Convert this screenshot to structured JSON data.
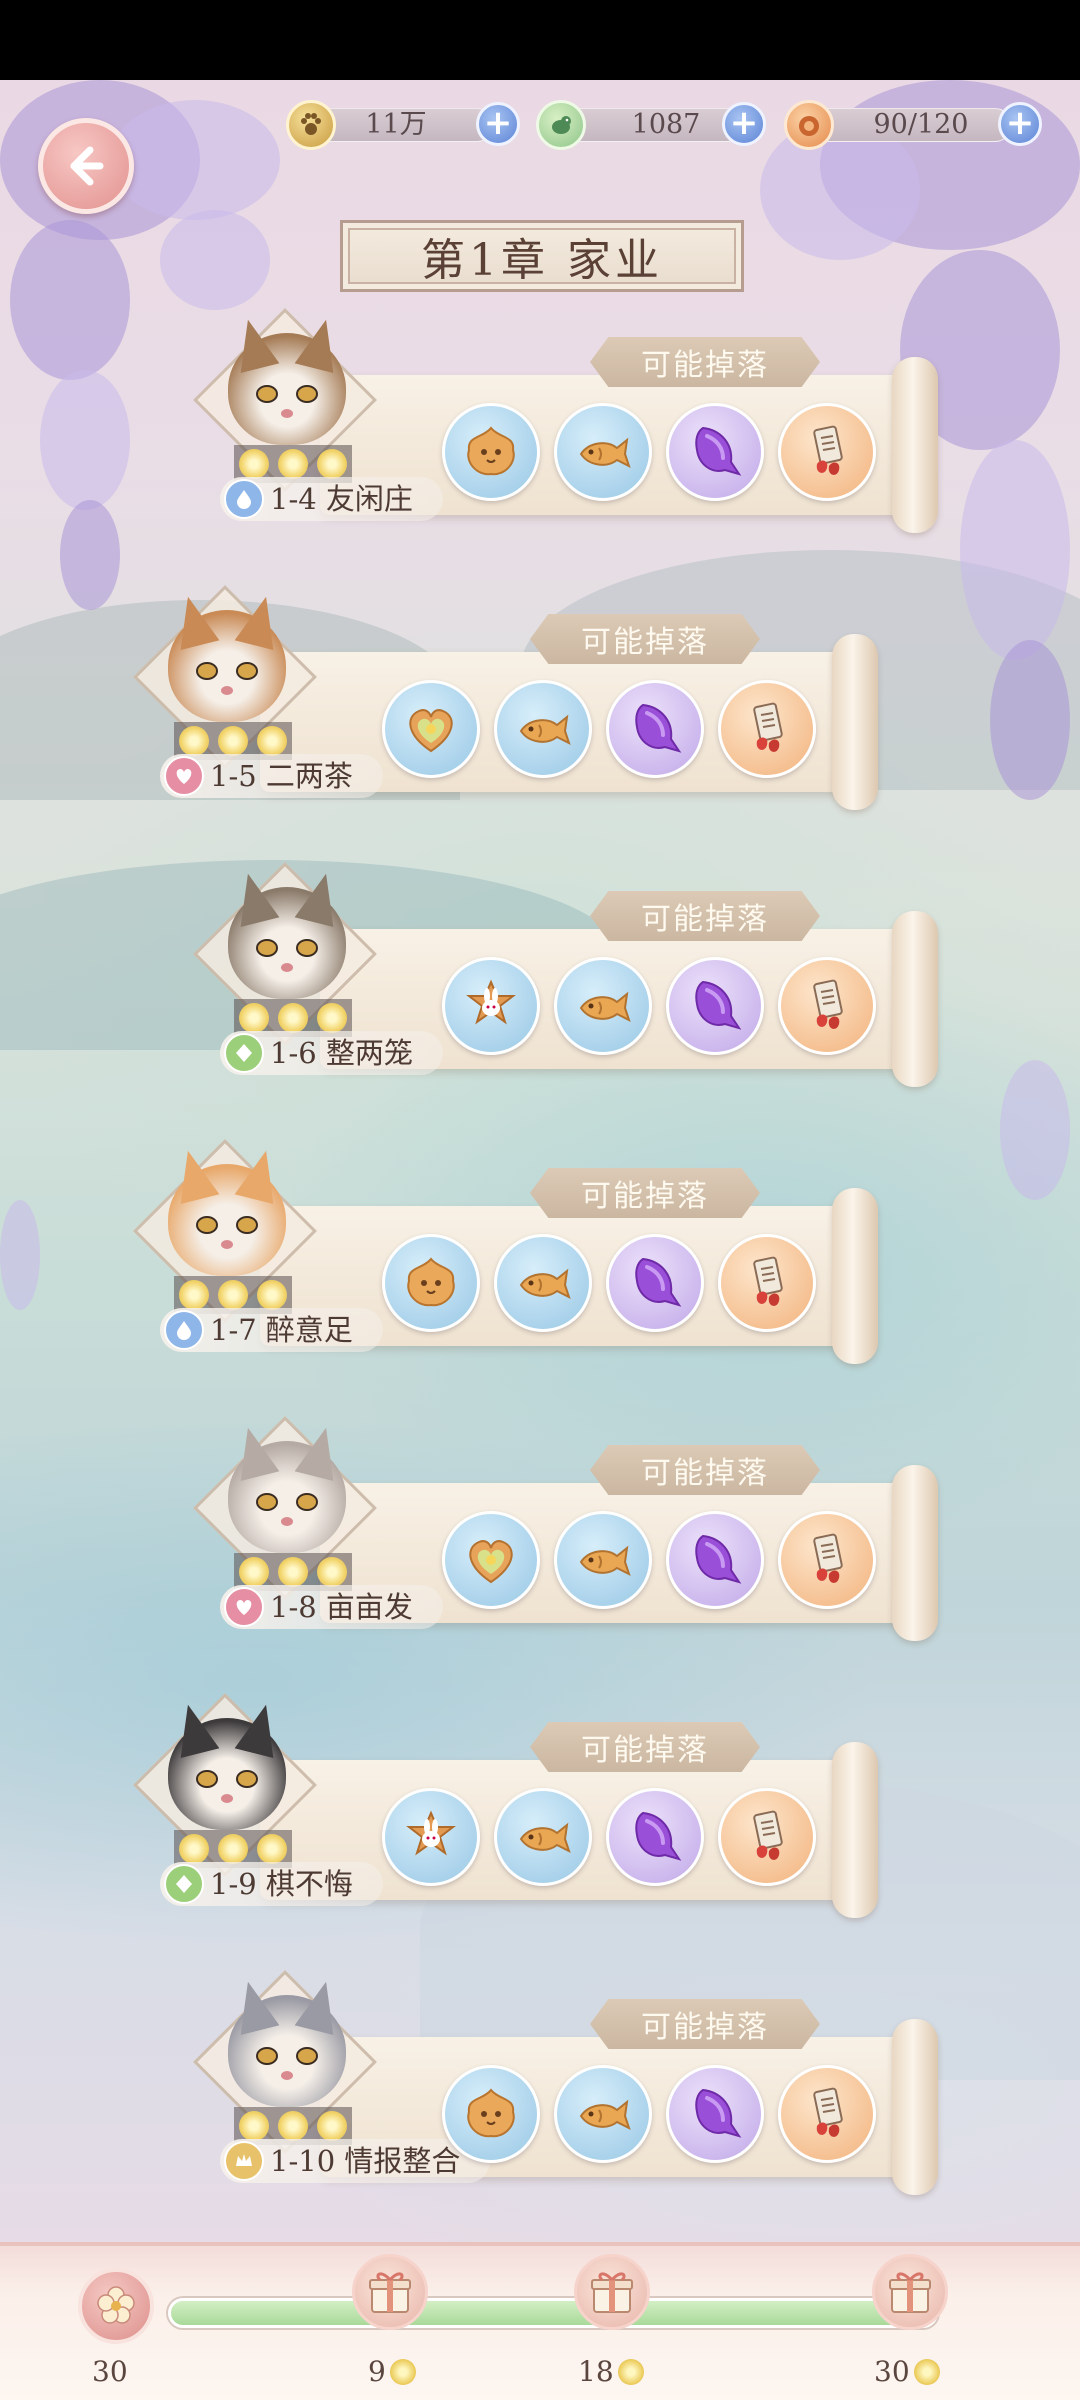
{
  "currencies": [
    {
      "name": "paw-coins",
      "value": "11万"
    },
    {
      "name": "jade-bird",
      "value": "1087"
    },
    {
      "name": "stamina",
      "value": "90/120"
    }
  ],
  "chapter": {
    "title": "第1章  家业"
  },
  "drop_label": "可能掉落",
  "stages": [
    {
      "name": "1-4 友闲庄",
      "icon": "blue-drop-icon",
      "icon_color": "#8fb6e8",
      "stars": 3,
      "fur": "#a57b55",
      "drops": [
        "cat-cookie-icon",
        "fish-snack-icon",
        "purple-fish-icon",
        "scroll-charm-icon"
      ]
    },
    {
      "name": "1-5 二两茶",
      "icon": "pink-heart-icon",
      "icon_color": "#e58ea4",
      "stars": 3,
      "fur": "#c98a55",
      "drops": [
        "heart-cookie-icon",
        "fish-snack-icon",
        "purple-fish-icon",
        "scroll-charm-icon"
      ]
    },
    {
      "name": "1-6 整两笼",
      "icon": "green-leaf-icon",
      "icon_color": "#9ccf7a",
      "stars": 3,
      "fur": "#8a7a6a",
      "drops": [
        "rabbit-cookie-icon",
        "fish-snack-icon",
        "purple-fish-icon",
        "scroll-charm-icon"
      ]
    },
    {
      "name": "1-7 醉意足",
      "icon": "blue-drop-icon",
      "icon_color": "#8fb6e8",
      "stars": 3,
      "fur": "#e8a86a",
      "drops": [
        "cat-cookie-icon",
        "fish-snack-icon",
        "purple-fish-icon",
        "scroll-charm-icon"
      ]
    },
    {
      "name": "1-8 亩亩发",
      "icon": "pink-heart-icon",
      "icon_color": "#e58ea4",
      "stars": 3,
      "fur": "#b5aaa4",
      "drops": [
        "heart-cookie-icon",
        "fish-snack-icon",
        "purple-fish-icon",
        "scroll-charm-icon"
      ]
    },
    {
      "name": "1-9 棋不悔",
      "icon": "green-leaf-icon",
      "icon_color": "#9ccf7a",
      "stars": 3,
      "fur": "#3d3a3c",
      "drops": [
        "rabbit-cookie-icon",
        "fish-snack-icon",
        "purple-fish-icon",
        "scroll-charm-icon"
      ]
    },
    {
      "name": "1-10 情报整合",
      "icon": "gold-crown-icon",
      "icon_color": "#e8c26a",
      "stars": 3,
      "fur": "#9a9aa4",
      "drops": [
        "cat-cookie-icon",
        "fish-snack-icon",
        "purple-fish-icon",
        "scroll-charm-icon"
      ]
    }
  ],
  "progress": {
    "current_stars": "30",
    "fraction": 1.0,
    "milestones": [
      {
        "stars": "9",
        "icon": "gift-icon"
      },
      {
        "stars": "18",
        "icon": "gift-icon"
      },
      {
        "stars": "30",
        "icon": "gift-icon"
      }
    ]
  }
}
